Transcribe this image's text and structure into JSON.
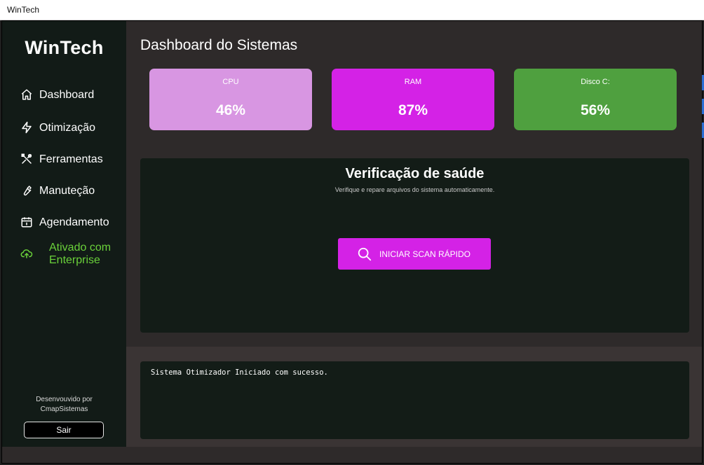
{
  "window": {
    "title": "WinTech"
  },
  "sidebar": {
    "brand": "WinTech",
    "items": [
      {
        "label": "Dashboard",
        "icon": "home-icon"
      },
      {
        "label": "Otimização",
        "icon": "lightning-icon"
      },
      {
        "label": "Ferramentas",
        "icon": "tools-icon"
      },
      {
        "label": "Manuteção",
        "icon": "wrench-icon"
      },
      {
        "label": "Agendamento",
        "icon": "calendar-icon"
      }
    ],
    "active_item": {
      "label_line1": "Ativado com",
      "label_line2": "Enterprise",
      "icon": "cloud-upload-icon"
    },
    "footer": {
      "line1": "Desenvouvido por",
      "line2": "CmapSistemas",
      "exit_label": "Sair"
    }
  },
  "main": {
    "title": "Dashboard do Sistemas",
    "cards": [
      {
        "label": "CPU",
        "value": "46%",
        "color": "#d896e2"
      },
      {
        "label": "RAM",
        "value": "87%",
        "color": "#d422e6"
      },
      {
        "label": "Disco C:",
        "value": "56%",
        "color": "#4fa03f"
      }
    ],
    "health": {
      "title": "Verificação de saúde",
      "subtitle": "Verifique e repare arquivos do sistema automaticamente.",
      "scan_label": "INICIAR SCAN RÁPIDO"
    },
    "log": {
      "text": "Sistema Otimizador Iniciado com sucesso."
    }
  },
  "colors": {
    "accent": "#d422e6",
    "active": "#6ad13a",
    "sidebar_bg": "#121b17",
    "panel_bg": "#131c17"
  }
}
